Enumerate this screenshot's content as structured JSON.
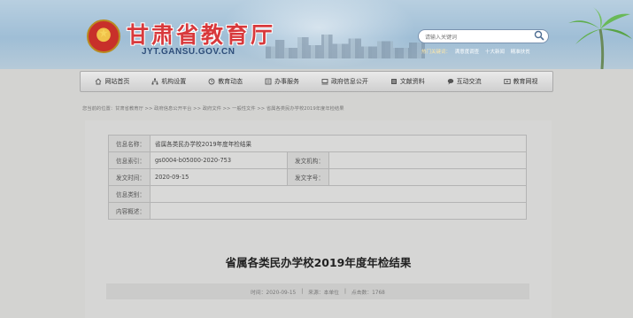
{
  "header": {
    "title": "甘肃省教育厅",
    "url": "JYT.GANSU.GOV.CN",
    "search_placeholder": "请输入关键词",
    "hot_label": "热门关键词：",
    "hot_words": [
      "满意度调查",
      "十大新闻",
      "精准扶贫"
    ]
  },
  "nav": {
    "items": [
      {
        "label": "网站首页",
        "icon": "home-icon"
      },
      {
        "label": "机构设置",
        "icon": "org-icon"
      },
      {
        "label": "教育动态",
        "icon": "news-icon"
      },
      {
        "label": "办事服务",
        "icon": "service-icon"
      },
      {
        "label": "政府信息公开",
        "icon": "disclosure-icon"
      },
      {
        "label": "文献资料",
        "icon": "document-icon"
      },
      {
        "label": "互动交流",
        "icon": "chat-icon"
      },
      {
        "label": "教育网视",
        "icon": "video-icon"
      }
    ]
  },
  "breadcrumb": "您当前的位置：甘肃省教育厅 >> 政府信息公开平台 >> 政府文件 >> 一般性文件 >> 省属各类民办学校2019年度年检结果",
  "info": {
    "name_label": "信息名称：",
    "name_value": "省属各类民办学校2019年度年检结果",
    "index_label": "信息索引：",
    "index_value": "gs0004-b05000-2020-753",
    "issuer_label": "发文机构：",
    "issuer_value": "",
    "date_label": "发文时间：",
    "date_value": "2020-09-15",
    "docno_label": "发文字号：",
    "docno_value": "",
    "category_label": "信息类别：",
    "category_value": "",
    "summary_label": "内容概述：",
    "summary_value": ""
  },
  "article": {
    "title": "省属各类民办学校2019年度年检结果",
    "meta": {
      "time": "时间：2020-09-15",
      "source": "来源：本单位",
      "clicks": "点击数：1768"
    }
  },
  "colors": {
    "title_red": "#d8393c",
    "url_blue": "#2e4e7a",
    "page_bg": "#d3d3d1"
  }
}
